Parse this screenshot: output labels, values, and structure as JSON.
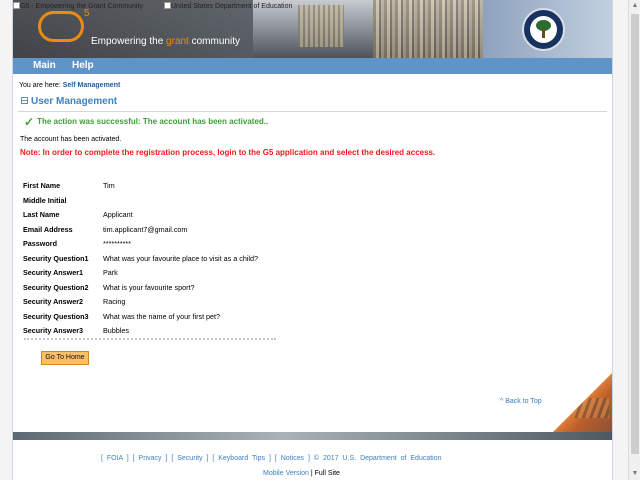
{
  "banner": {
    "g5_logo_alt": "G5 - Empowering the Grant Community",
    "education_logo_alt": "United States Department of Education",
    "logo_number": "5",
    "tagline_prefix": "Empowering the ",
    "tagline_highlight": "grant",
    "tagline_suffix": " community"
  },
  "nav": {
    "main": "Main",
    "help": "Help"
  },
  "breadcrumb": {
    "prefix": "You are here:",
    "current": "Self Management"
  },
  "page": {
    "title": "User Management",
    "success_message": "The action was successful: The account has been activated..",
    "activated_message": "The account has been activated.",
    "note": "Note: In order to complete the registration process, login to the G5 application and select the desired access."
  },
  "details": [
    {
      "label": "First Name",
      "value": "Tim"
    },
    {
      "label": "Middle Initial",
      "value": ""
    },
    {
      "label": "Last Name",
      "value": "Applicant"
    },
    {
      "label": "Email Address",
      "value": "tim.applicant7@gmail.com"
    },
    {
      "label": "Password",
      "value": "**********"
    },
    {
      "label": "Security Question1",
      "value": "What was your favourite place to visit as a child?"
    },
    {
      "label": "Security Answer1",
      "value": "Park"
    },
    {
      "label": "Security Question2",
      "value": "What is your favourite sport?"
    },
    {
      "label": "Security Answer2",
      "value": "Racing"
    },
    {
      "label": "Security Question3",
      "value": "What was the name of your first pet?"
    },
    {
      "label": "Security Answer3",
      "value": "Bubbles"
    }
  ],
  "actions": {
    "home_button": "Go To Home",
    "back_to_top": "^ Back to Top"
  },
  "footer": {
    "links": "[ FOIA ] [ Privacy ] [ Security ] [ Keyboard Tips ] [ Notices ]",
    "copyright": "© 2017 U.S. Department of Education",
    "mobile": "Mobile Version",
    "separator": "|",
    "full_site": "Full Site"
  },
  "icons": {
    "check": "✓",
    "scroll_up": "▲",
    "scroll_down": "▼",
    "broken_image": "broken-image-icon",
    "title": "list-icon"
  },
  "colors": {
    "nav": "#5f94c9",
    "title": "#3f82c3",
    "success": "#3c9f35",
    "note": "#ef1b1b",
    "button": "#f8be68",
    "link": "#3f80c0"
  }
}
